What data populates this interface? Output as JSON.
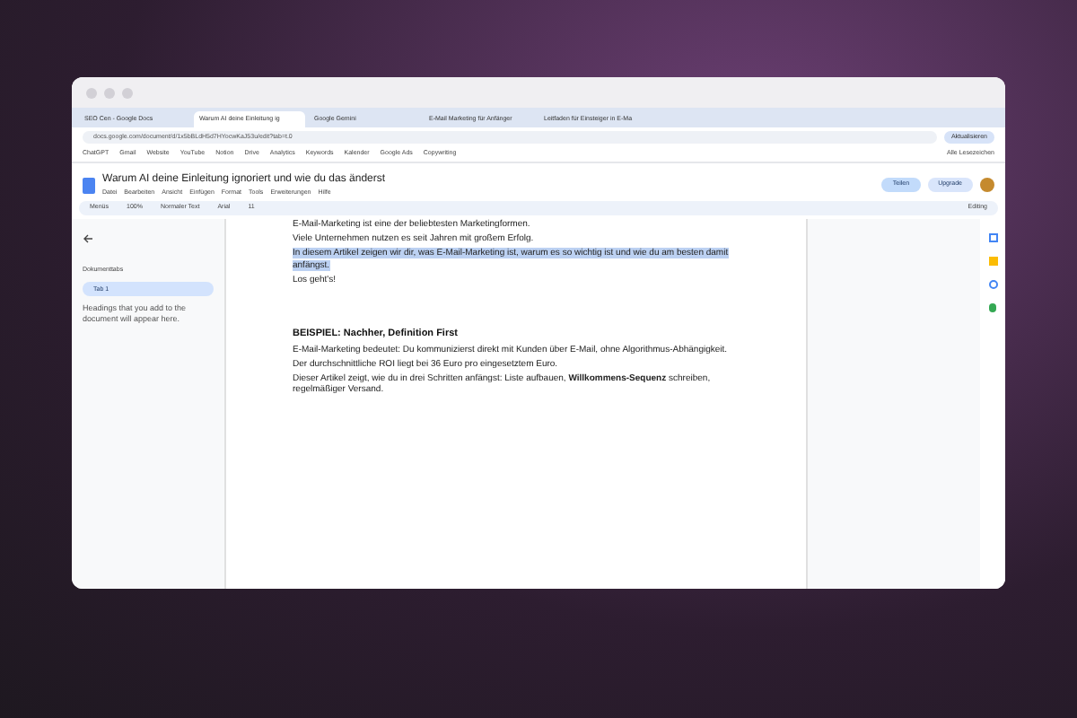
{
  "tabs": [
    {
      "label": "SEO Cen - Google Docs",
      "selected": false
    },
    {
      "label": "Warum AI deine Einleitung ig",
      "selected": true
    },
    {
      "label": "Google Gemini",
      "selected": false
    },
    {
      "label": "E-Mail Marketing für Anfänger",
      "selected": false
    },
    {
      "label": "Leitfaden für Einsteiger in E-Ma",
      "selected": false
    }
  ],
  "address": "docs.google.com/document/d/1x5bBLdH5d7HYocwKaJ53u/edit?tab=t.0",
  "profile_button": "Aktualisieren",
  "bookmarks": [
    "ChatGPT",
    "Gmail",
    "Website",
    "YouTube",
    "Notion",
    "Drive",
    "Analytics",
    "Keywords",
    "Kalender",
    "Google Ads",
    "Copywriting"
  ],
  "all_bookmarks": "Alle Lesezeichen",
  "doc": {
    "title": "Warum AI deine Einleitung ignoriert und wie du das änderst",
    "menus": [
      "Datei",
      "Bearbeiten",
      "Ansicht",
      "Einfügen",
      "Format",
      "Tools",
      "Erweiterungen",
      "Hilfe"
    ],
    "share": "Teilen",
    "upgrade": "Upgrade"
  },
  "toolbar": {
    "search": "Menüs",
    "zoom": "100%",
    "style": "Normaler Text",
    "font": "Arial",
    "size": "11",
    "mode": "Editing"
  },
  "sidebar": {
    "heading": "Dokumenttabs",
    "tabs": [
      {
        "label": "Tab 1",
        "selected": true
      }
    ],
    "note": "Headings that you add to the document will appear here."
  },
  "paragraphs": [
    {
      "kind": "text",
      "text": "E-Mail-Marketing ist eine der beliebtesten Marketingformen."
    },
    {
      "kind": "text",
      "text": "Viele Unternehmen nutzen es seit Jahren mit großem Erfolg."
    },
    {
      "kind": "selected",
      "text": "In diesem Artikel zeigen wir dir, was E-Mail-Marketing ist, warum es so wichtig ist und wie du am besten damit anfängst."
    },
    {
      "kind": "text",
      "text": "Los geht's!"
    },
    {
      "kind": "gap"
    },
    {
      "kind": "heading",
      "text": "BEISPIEL: Nachher, Definition First"
    },
    {
      "kind": "text",
      "text": "E-Mail-Marketing bedeutet: Du kommunizierst direkt mit Kunden über E-Mail, ohne Algorithmus-Abhängigkeit."
    },
    {
      "kind": "text",
      "text": "Der durchschnittliche ROI liegt bei 36 Euro pro eingesetztem Euro."
    },
    {
      "kind": "text",
      "text": "Dieser Artikel zeigt, wie du in drei Schritten anfängst: Liste aufbauen, **Willkommens-Sequenz** schreiben, regelmäßiger Versand."
    }
  ]
}
